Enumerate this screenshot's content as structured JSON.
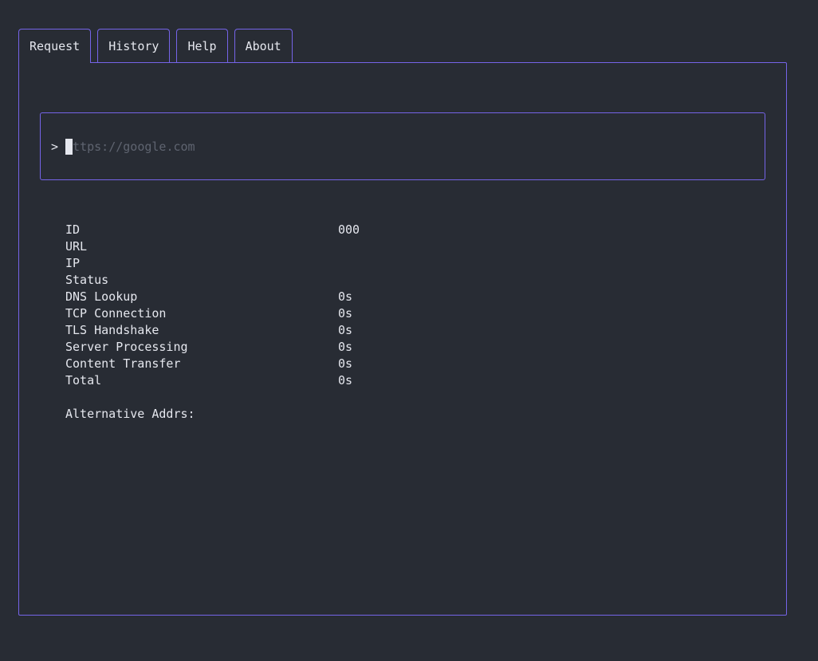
{
  "tabs": [
    {
      "label": "Request",
      "active": true
    },
    {
      "label": "History",
      "active": false
    },
    {
      "label": "Help",
      "active": false
    },
    {
      "label": "About",
      "active": false
    }
  ],
  "input": {
    "prompt": ">",
    "value": "",
    "placeholder": "https://google.com"
  },
  "stats": [
    {
      "label": "ID",
      "value": "000"
    },
    {
      "label": "URL",
      "value": ""
    },
    {
      "label": "IP",
      "value": ""
    },
    {
      "label": "Status",
      "value": ""
    },
    {
      "label": "DNS Lookup",
      "value": "0s"
    },
    {
      "label": "TCP Connection",
      "value": "0s"
    },
    {
      "label": "TLS Handshake",
      "value": "0s"
    },
    {
      "label": "Server Processing",
      "value": "0s"
    },
    {
      "label": "Content Transfer",
      "value": "0s"
    },
    {
      "label": "Total",
      "value": "0s"
    }
  ],
  "alternative_addrs_label": "Alternative Addrs:",
  "colors": {
    "background": "#282c34",
    "accent_border": "#7564e8",
    "text": "#e5e7ee",
    "placeholder": "#5f6470"
  }
}
